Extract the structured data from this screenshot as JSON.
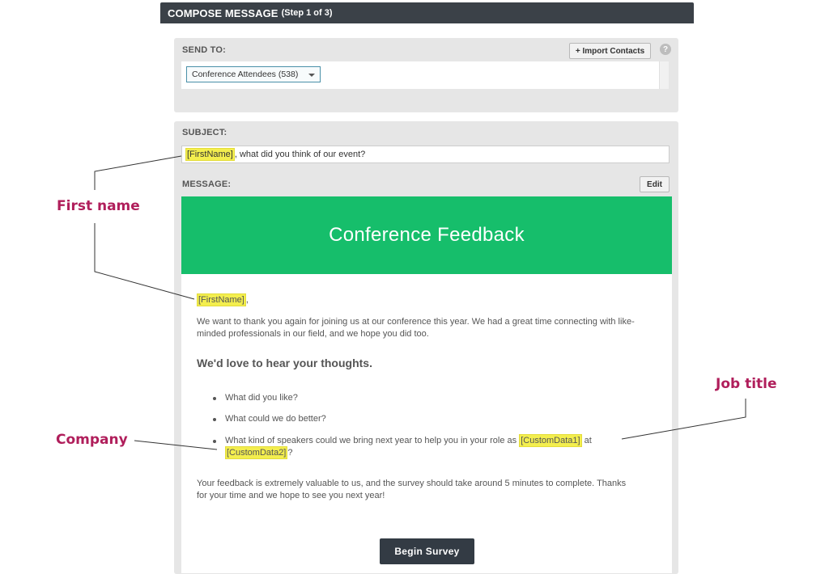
{
  "header": {
    "title": "COMPOSE MESSAGE",
    "step": "(Step 1 of 3)"
  },
  "send_to": {
    "label": "SEND TO:",
    "import_button": "+ Import Contacts",
    "help_glyph": "?",
    "selected_list": "Conference Attendees (538)"
  },
  "subject": {
    "label": "SUBJECT:",
    "tag": "[FirstName]",
    "text": ", what did you think of our event?"
  },
  "message": {
    "label": "MESSAGE:",
    "edit_button": "Edit",
    "banner_title": "Conference Feedback",
    "greeting_tag": "[FirstName]",
    "greeting_suffix": ",",
    "intro_line1": "We want to thank you again for joining us at our conference this year. We had a great time connecting with like-",
    "intro_line2": "minded professionals in our field, and we hope you did too.",
    "heading": "We'd love to hear your thoughts.",
    "bullets": [
      "What did you like?",
      "What could we do better?"
    ],
    "bullet3_part1": "What kind of speakers could we bring next year to help you in your role as ",
    "bullet3_tag1": "[CustomData1]",
    "bullet3_part2": " at",
    "bullet3_tag2": "[CustomData2]",
    "bullet3_part3": "?",
    "closing_line1": "Your feedback is extremely valuable to us, and the survey should take around 5 minutes to complete. Thanks",
    "closing_line2": "for your time and we hope to see you next year!",
    "cta_button": "Begin Survey"
  },
  "annotations": {
    "first_name": "First name",
    "job_title": "Job title",
    "company": "Company"
  },
  "colors": {
    "annotation": "#b01e5b",
    "banner": "#16be6b",
    "tag_highlight": "#f3ee4e",
    "header_bar": "#3b4148"
  }
}
